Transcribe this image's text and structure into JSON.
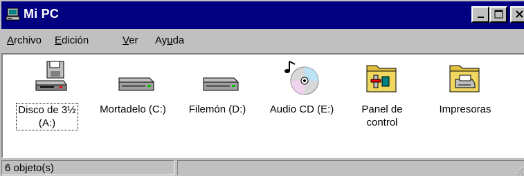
{
  "window": {
    "title": "Mi PC",
    "icon": "computer-icon"
  },
  "menu": [
    {
      "prefix": "",
      "accel": "A",
      "rest": "rchivo"
    },
    {
      "prefix": "",
      "accel": "E",
      "rest": "dición"
    },
    {
      "prefix": "",
      "accel": "V",
      "rest": "er"
    },
    {
      "prefix": "Ay",
      "accel": "u",
      "rest": "da"
    }
  ],
  "items": [
    {
      "line1": "Disco de 3½",
      "line2": "(A:)",
      "icon": "floppy-drive-icon"
    },
    {
      "line1": "Mortadelo (C:)",
      "line2": "",
      "icon": "hard-drive-icon"
    },
    {
      "line1": "Filemón (D:)",
      "line2": "",
      "icon": "hard-drive-icon"
    },
    {
      "line1": "Audio CD (E:)",
      "line2": "",
      "icon": "audio-cd-icon"
    },
    {
      "line1": "Panel de",
      "line2": "control",
      "icon": "control-panel-folder-icon"
    },
    {
      "line1": "Impresoras",
      "line2": "",
      "icon": "printers-folder-icon"
    }
  ],
  "status": {
    "objects": "6 objeto(s)"
  }
}
